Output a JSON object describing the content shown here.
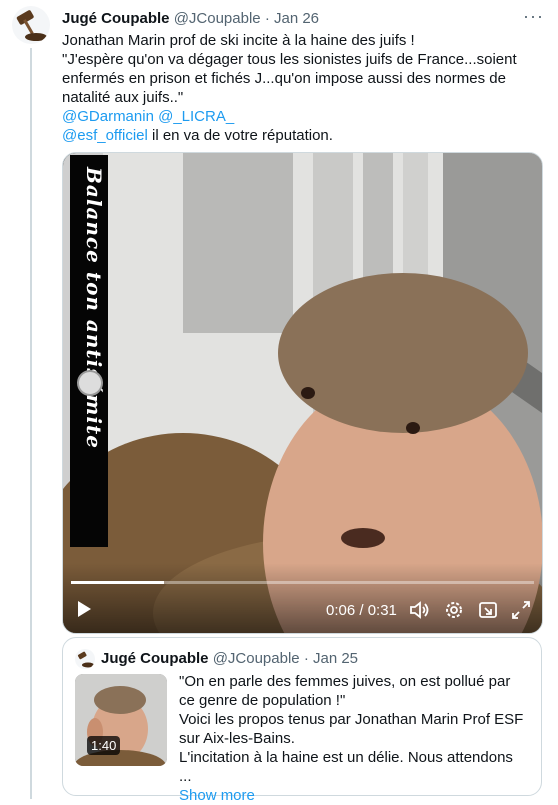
{
  "tweet": {
    "author_name": "Jugé Coupable",
    "handle": "@JCoupable",
    "separator": "·",
    "date": "Jan 26",
    "more": "···",
    "lines": [
      "Jonathan Marin prof de ski incite à la haine des juifs !",
      "\"J'espère qu'on va dégager tous les sionistes juifs de France...soient enfermés en prison et fichés J...qu'on impose aussi des normes de natalité aux juifs..\""
    ],
    "mentions_line": "@GDarmanin @_LICRA_",
    "last_line_mention": "@esf_officiel",
    "last_line_text": " il en va de votre réputation."
  },
  "video": {
    "banner_text": "Balance ton antisémite",
    "time": "0:06 / 0:31",
    "progress": 0.2,
    "icons": [
      "play-icon",
      "volume-icon",
      "settings-icon",
      "pip-icon",
      "fullscreen-icon"
    ]
  },
  "quote": {
    "author_name": "Jugé Coupable",
    "handle": "@JCoupable",
    "separator": "·",
    "date": "Jan 25",
    "thumb_duration": "1:40",
    "lines": [
      "\"On en parle des femmes juives, on est pollué par ce genre de population !\"",
      "Voici les propos tenus par Jonathan Marin Prof ESF sur Aix-les-Bains.",
      "L'incitation à la haine est un délie. Nous attendons ..."
    ],
    "show_more": "Show more"
  },
  "colors": {
    "link": "#1d9bf0",
    "muted": "#536471",
    "border": "#cfd9de"
  }
}
